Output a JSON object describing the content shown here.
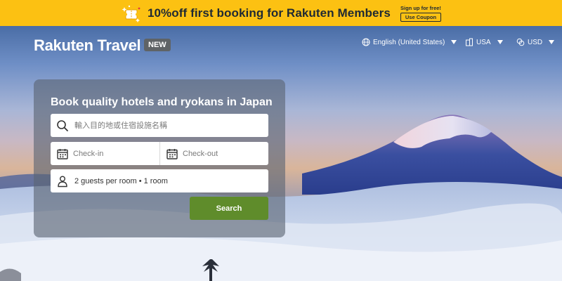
{
  "promo": {
    "icon": "ticket-sparkle-icon",
    "text": "10%off first booking for Rakuten Members",
    "signup": "Sign up for free!",
    "coupon_button": "Use Coupon",
    "background": "#fcc112"
  },
  "header": {
    "logo": "Rakuten Travel",
    "badge": "NEW",
    "language": "English (United States)",
    "country": "USA",
    "currency": "USD"
  },
  "search": {
    "title": "Book quality hotels and ryokans in Japan",
    "destination_placeholder": "輸入目的地或住宿設施名稱",
    "checkin_placeholder": "Check-in",
    "checkout_placeholder": "Check-out",
    "guests": "2 guests per room • 1 room",
    "search_button": "Search",
    "button_color": "#5f8c2b"
  }
}
